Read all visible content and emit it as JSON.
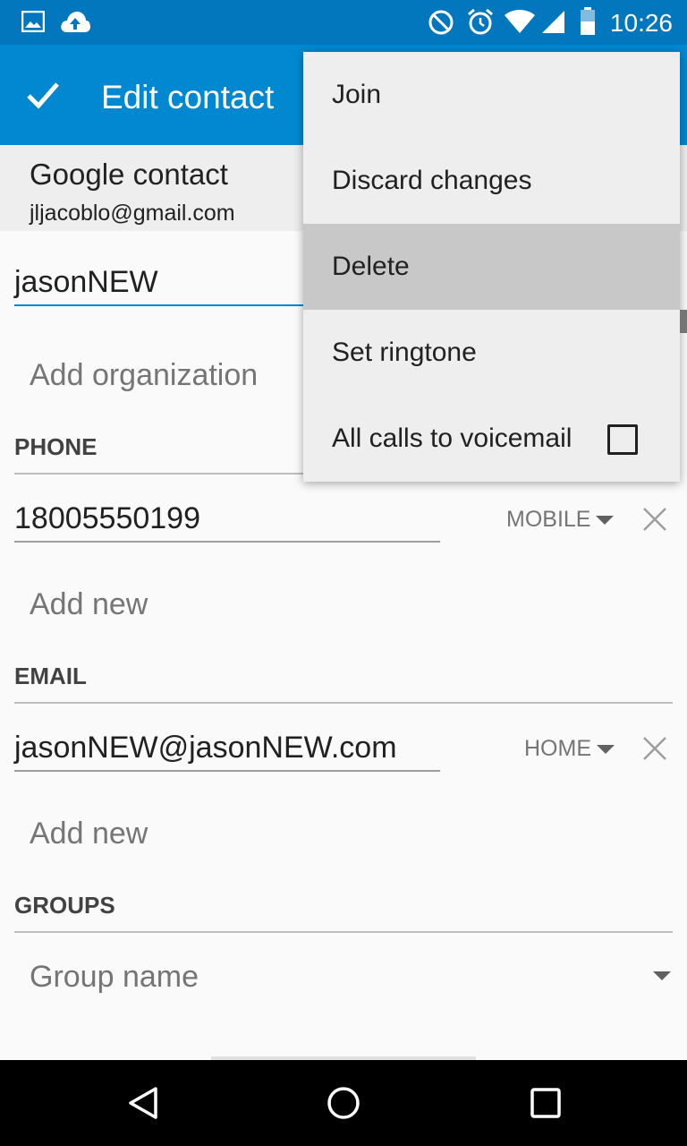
{
  "status_bar": {
    "time": "10:26",
    "icons": [
      "image-icon",
      "cloud-upload-icon",
      "do-not-disturb-icon",
      "alarm-icon",
      "wifi-icon",
      "cell-signal-icon",
      "battery-icon"
    ]
  },
  "app_bar": {
    "title": "Edit contact",
    "done_icon": "check-icon"
  },
  "account": {
    "type": "Google contact",
    "email": "jljacoblo@gmail.com"
  },
  "form": {
    "name_value": "jasonNEW",
    "organization_placeholder": "Add organization",
    "phone": {
      "section_title": "PHONE",
      "value": "18005550199",
      "type": "MOBILE",
      "add_new": "Add new"
    },
    "email": {
      "section_title": "EMAIL",
      "value": "jasonNEW@jasonNEW.com",
      "type": "HOME",
      "add_new": "Add new"
    },
    "groups": {
      "section_title": "GROUPS",
      "placeholder": "Group name"
    }
  },
  "overflow_menu": {
    "items": [
      {
        "label": "Join"
      },
      {
        "label": "Discard changes"
      },
      {
        "label": "Delete",
        "selected": true
      },
      {
        "label": "Set ringtone"
      },
      {
        "label": "All calls to voicemail",
        "checked": false
      }
    ]
  },
  "nav_bar": {
    "buttons": [
      "back-icon",
      "home-icon",
      "recents-icon"
    ]
  },
  "colors": {
    "status_bar": "#0277bd",
    "app_bar": "#0288d1",
    "accent": "#0288d1",
    "menu_bg": "#eeeeee",
    "menu_selected": "#c8c8c8"
  }
}
